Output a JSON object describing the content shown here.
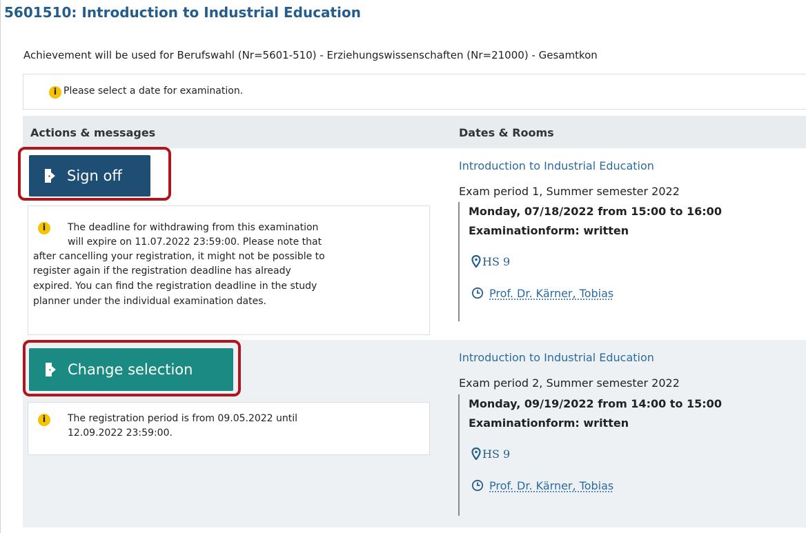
{
  "course": {
    "title": "5601510: Introduction to Industrial Education",
    "achievement_text": "Achievement will be used for Berufswahl (Nr=5601-510) - Erziehungswissenschaften (Nr=21000) - Gesamtkon"
  },
  "notice": {
    "icon": "info-icon",
    "text": "Please select a date for examination."
  },
  "table": {
    "headers": {
      "actions": "Actions & messages",
      "dates": "Dates & Rooms"
    },
    "rows": [
      {
        "button_label": "Sign off",
        "button_icon": "door-exit-icon",
        "button_color": "#1f4e74",
        "message_lines": [
          "The deadline for withdrawing from this examination",
          "will expire on 11.07.2022 23:59:00. Please note that",
          "after cancelling your registration, it might not be possible to",
          "register again if the registration deadline has already",
          "expired. You can find the registration deadline in the study",
          "planner under the individual examination dates."
        ],
        "exam_title": "Introduction to Industrial Education",
        "exam_period": "Exam period 1, Summer semester 2022",
        "exam_date": "Monday, 07/18/2022 from 15:00 to 16:00",
        "exam_form": "Examinationform: written",
        "room": "HS  9",
        "lecturer": "Prof. Dr. Kärner, Tobias"
      },
      {
        "button_label": "Change selection",
        "button_icon": "door-exit-icon",
        "button_color": "#1a8a82",
        "message_lines": [
          "The registration period is from 09.05.2022 until",
          "12.09.2022 23:59:00."
        ],
        "exam_title": "Introduction to Industrial Education",
        "exam_period": "Exam period 2, Summer semester 2022",
        "exam_date": "Monday, 09/19/2022 from 14:00 to 15:00",
        "exam_form": "Examinationform: written",
        "room": "HS  9",
        "lecturer": "Prof. Dr. Kärner, Tobias"
      }
    ]
  },
  "colors": {
    "title": "#245d8c",
    "link": "#2c6aa0",
    "highlight": "#b3141b",
    "info_icon": "#f5c400",
    "header_bg": "#e9ecef"
  }
}
